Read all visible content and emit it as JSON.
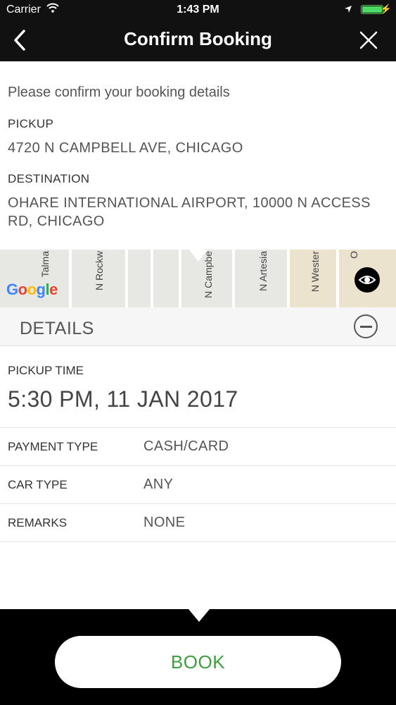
{
  "status_bar": {
    "carrier": "Carrier",
    "time": "1:43 PM",
    "wifi_icon": "wifi-icon",
    "battery_icon": "battery-icon"
  },
  "nav": {
    "title": "Confirm Booking",
    "back_icon": "chevron-left-icon",
    "close_icon": "close-icon"
  },
  "booking": {
    "prompt": "Please confirm your booking details",
    "pickup_label": "PICKUP",
    "pickup_value": "4720 N CAMPBELL AVE, CHICAGO",
    "destination_label": "DESTINATION",
    "destination_value": "OHARE INTERNATIONAL AIRPORT, 10000 N ACCESS RD, CHICAGO"
  },
  "map": {
    "streets": [
      "Talma",
      "N Rockw",
      "N Campbe",
      "N Artesia",
      "N Wester",
      "O"
    ],
    "logo": "Google",
    "eye_icon": "eye-icon"
  },
  "details": {
    "header": "DETAILS",
    "toggle_icon": "minus-circle-icon",
    "pickup_time_label": "PICKUP TIME",
    "pickup_time_value": "5:30 PM, 11 JAN 2017",
    "rows": [
      {
        "label": "PAYMENT TYPE",
        "value": "CASH/CARD"
      },
      {
        "label": "CAR TYPE",
        "value": "ANY"
      },
      {
        "label": "REMARKS",
        "value": "NONE"
      }
    ]
  },
  "footer": {
    "book_label": "BOOK",
    "book_color": "#3f9e3f"
  }
}
